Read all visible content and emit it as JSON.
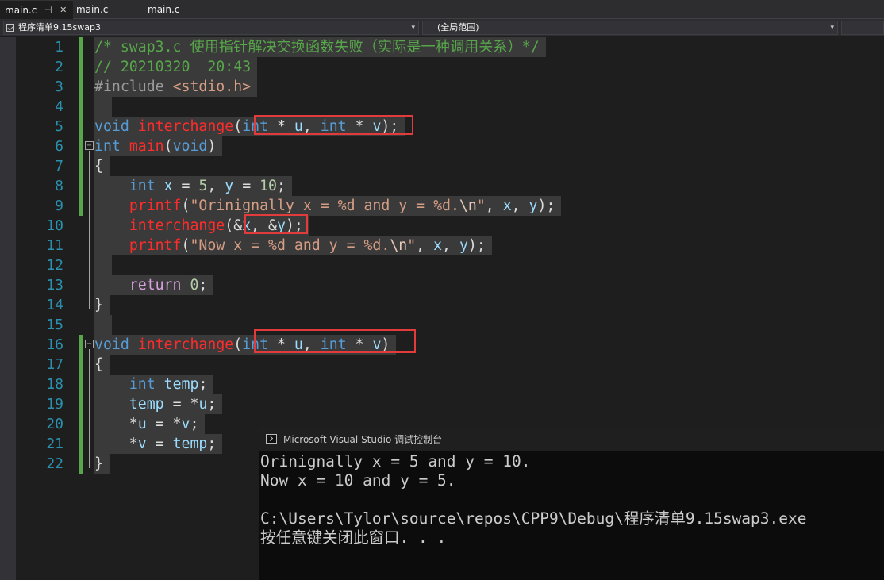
{
  "tabs": [
    {
      "label": "main.c",
      "active": true
    },
    {
      "label": "main.c",
      "active": false
    },
    {
      "label": "main.c",
      "active": false
    }
  ],
  "tab_icons": {
    "pin": "⊣",
    "close": "✕"
  },
  "navbar": {
    "project": "程序清单9.15swap3",
    "scope": "(全局范围)",
    "arrow": "▾"
  },
  "code": {
    "lines": [
      {
        "n": "1",
        "tokens": [
          [
            "cm",
            "/* swap3.c 使用指针解决交换函数失败（实际是一种调用关系）*/"
          ]
        ]
      },
      {
        "n": "2",
        "tokens": [
          [
            "cm",
            "// 20210320  20:43"
          ]
        ]
      },
      {
        "n": "3",
        "tokens": [
          [
            "pp",
            "#include "
          ],
          [
            "st",
            "<stdio.h>"
          ]
        ]
      },
      {
        "n": "4",
        "tokens": []
      },
      {
        "n": "5",
        "tokens": [
          [
            "kw",
            "void"
          ],
          [
            "pl",
            " "
          ],
          [
            "fn",
            "interchange"
          ],
          [
            "pl",
            "("
          ],
          [
            "kw",
            "int"
          ],
          [
            "pl",
            " * "
          ],
          [
            "vr",
            "u"
          ],
          [
            "pl",
            ", "
          ],
          [
            "kw",
            "int"
          ],
          [
            "pl",
            " * "
          ],
          [
            "vr",
            "v"
          ],
          [
            "pl",
            ");"
          ]
        ]
      },
      {
        "n": "6",
        "tokens": [
          [
            "kw",
            "int"
          ],
          [
            "pl",
            " "
          ],
          [
            "fn",
            "main"
          ],
          [
            "pl",
            "("
          ],
          [
            "kw",
            "void"
          ],
          [
            "pl",
            ")"
          ]
        ]
      },
      {
        "n": "7",
        "tokens": [
          [
            "pl",
            "{"
          ]
        ]
      },
      {
        "n": "8",
        "tokens": [
          [
            "pl",
            "    "
          ],
          [
            "kw",
            "int"
          ],
          [
            "pl",
            " "
          ],
          [
            "vr",
            "x"
          ],
          [
            "pl",
            " = "
          ],
          [
            "nm",
            "5"
          ],
          [
            "pl",
            ", "
          ],
          [
            "vr",
            "y"
          ],
          [
            "pl",
            " = "
          ],
          [
            "nm",
            "10"
          ],
          [
            "pl",
            ";"
          ]
        ]
      },
      {
        "n": "9",
        "tokens": [
          [
            "pl",
            "    "
          ],
          [
            "fn",
            "printf"
          ],
          [
            "pl",
            "("
          ],
          [
            "st",
            "\"Orinignally x = %d and y = %d."
          ],
          [
            "es",
            "\\n"
          ],
          [
            "st",
            "\""
          ],
          [
            "pl",
            ", "
          ],
          [
            "vr",
            "x"
          ],
          [
            "pl",
            ", "
          ],
          [
            "vr",
            "y"
          ],
          [
            "pl",
            ");"
          ]
        ]
      },
      {
        "n": "10",
        "tokens": [
          [
            "pl",
            "    "
          ],
          [
            "fn",
            "interchange"
          ],
          [
            "pl",
            "(&"
          ],
          [
            "vr",
            "x"
          ],
          [
            "pl",
            ", &"
          ],
          [
            "vr",
            "y"
          ],
          [
            "pl",
            ");"
          ]
        ]
      },
      {
        "n": "11",
        "tokens": [
          [
            "pl",
            "    "
          ],
          [
            "fn",
            "printf"
          ],
          [
            "pl",
            "("
          ],
          [
            "st",
            "\"Now x = %d and y = %d."
          ],
          [
            "es",
            "\\n"
          ],
          [
            "st",
            "\""
          ],
          [
            "pl",
            ", "
          ],
          [
            "vr",
            "x"
          ],
          [
            "pl",
            ", "
          ],
          [
            "vr",
            "y"
          ],
          [
            "pl",
            ");"
          ]
        ]
      },
      {
        "n": "12",
        "tokens": []
      },
      {
        "n": "13",
        "tokens": [
          [
            "pl",
            "    "
          ],
          [
            "ct",
            "return"
          ],
          [
            "pl",
            " "
          ],
          [
            "nm",
            "0"
          ],
          [
            "pl",
            ";"
          ]
        ]
      },
      {
        "n": "14",
        "tokens": [
          [
            "pl",
            "}"
          ]
        ]
      },
      {
        "n": "15",
        "tokens": []
      },
      {
        "n": "16",
        "tokens": [
          [
            "kw",
            "void"
          ],
          [
            "pl",
            " "
          ],
          [
            "fn",
            "interchange"
          ],
          [
            "pl",
            "("
          ],
          [
            "kw",
            "int"
          ],
          [
            "pl",
            " * "
          ],
          [
            "vr",
            "u"
          ],
          [
            "pl",
            ", "
          ],
          [
            "kw",
            "int"
          ],
          [
            "pl",
            " * "
          ],
          [
            "vr",
            "v"
          ],
          [
            "pl",
            ")"
          ]
        ]
      },
      {
        "n": "17",
        "tokens": [
          [
            "pl",
            "{"
          ]
        ]
      },
      {
        "n": "18",
        "tokens": [
          [
            "pl",
            "    "
          ],
          [
            "kw",
            "int"
          ],
          [
            "pl",
            " "
          ],
          [
            "vr",
            "temp"
          ],
          [
            "pl",
            ";"
          ]
        ]
      },
      {
        "n": "19",
        "tokens": [
          [
            "pl",
            "    "
          ],
          [
            "vr",
            "temp"
          ],
          [
            "pl",
            " = *"
          ],
          [
            "vr",
            "u"
          ],
          [
            "pl",
            ";"
          ]
        ]
      },
      {
        "n": "20",
        "tokens": [
          [
            "pl",
            "    *"
          ],
          [
            "vr",
            "u"
          ],
          [
            "pl",
            " = *"
          ],
          [
            "vr",
            "v"
          ],
          [
            "pl",
            ";"
          ]
        ]
      },
      {
        "n": "21",
        "tokens": [
          [
            "pl",
            "    *"
          ],
          [
            "vr",
            "v"
          ],
          [
            "pl",
            " = "
          ],
          [
            "vr",
            "temp"
          ],
          [
            "pl",
            ";"
          ]
        ]
      },
      {
        "n": "22",
        "tokens": [
          [
            "pl",
            "}"
          ]
        ]
      }
    ]
  },
  "console": {
    "title": "Microsoft Visual Studio 调试控制台",
    "lines": [
      "Orinignally x = 5 and y = 10.",
      "Now x = 10 and y = 5.",
      "",
      "C:\\Users\\Tylor\\source\\repos\\CPP9\\Debug\\程序清单9.15swap3.exe",
      "按任意键关闭此窗口. . ."
    ]
  },
  "colors": {
    "comment": "#57a64a",
    "keyword": "#569cd6",
    "function": "#ff2c2c",
    "variable": "#9cdcfe",
    "number": "#b5cea8",
    "string": "#d69d85",
    "control": "#d8a0df",
    "highlight_box": "#e23b3b"
  }
}
